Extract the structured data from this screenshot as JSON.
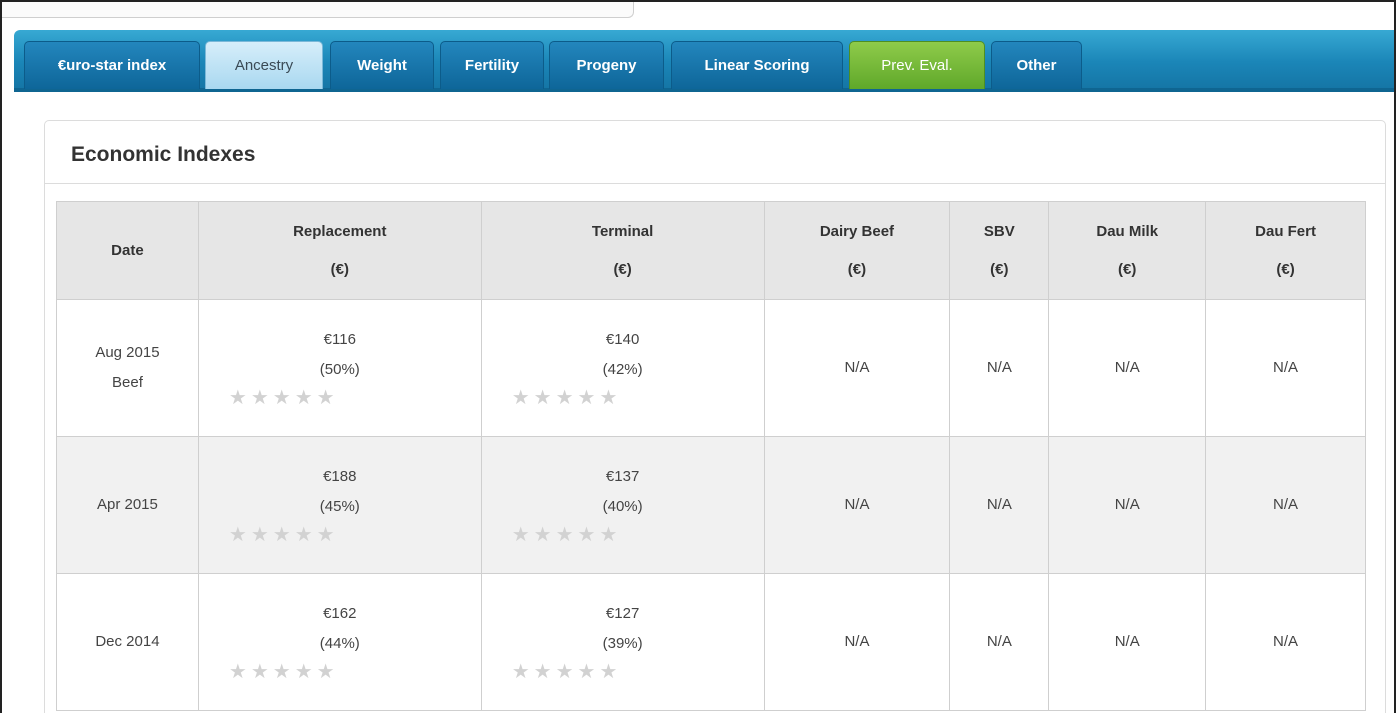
{
  "tabs": [
    {
      "label": "€uro-star index",
      "state": "default"
    },
    {
      "label": "Ancestry",
      "state": "active"
    },
    {
      "label": "Weight",
      "state": "default"
    },
    {
      "label": "Fertility",
      "state": "default"
    },
    {
      "label": "Progeny",
      "state": "default"
    },
    {
      "label": "Linear Scoring",
      "state": "default"
    },
    {
      "label": "Prev. Eval.",
      "state": "green"
    },
    {
      "label": "Other",
      "state": "default"
    }
  ],
  "panel": {
    "title": "Economic Indexes",
    "columns": [
      {
        "name": "Date",
        "unit": ""
      },
      {
        "name": "Replacement",
        "unit": "(€)"
      },
      {
        "name": "Terminal",
        "unit": "(€)"
      },
      {
        "name": "Dairy Beef",
        "unit": "(€)"
      },
      {
        "name": "SBV",
        "unit": "(€)"
      },
      {
        "name": "Dau Milk",
        "unit": "(€)"
      },
      {
        "name": "Dau Fert",
        "unit": "(€)"
      }
    ],
    "rows": [
      {
        "date": "Aug 2015",
        "date_sub": "Beef",
        "replacement": {
          "value": "€116",
          "reliability": "(50%)",
          "stars_filled": 0,
          "stars_total": 5
        },
        "terminal": {
          "value": "€140",
          "reliability": "(42%)",
          "stars_filled": 0,
          "stars_total": 5
        },
        "dairy_beef": "N/A",
        "sbv": "N/A",
        "dau_milk": "N/A",
        "dau_fert": "N/A"
      },
      {
        "date": "Apr 2015",
        "date_sub": "",
        "replacement": {
          "value": "€188",
          "reliability": "(45%)",
          "stars_filled": 0,
          "stars_total": 5
        },
        "terminal": {
          "value": "€137",
          "reliability": "(40%)",
          "stars_filled": 0,
          "stars_total": 5
        },
        "dairy_beef": "N/A",
        "sbv": "N/A",
        "dau_milk": "N/A",
        "dau_fert": "N/A"
      },
      {
        "date": "Dec 2014",
        "date_sub": "",
        "replacement": {
          "value": "€162",
          "reliability": "(44%)",
          "stars_filled": 0,
          "stars_total": 5
        },
        "terminal": {
          "value": "€127",
          "reliability": "(39%)",
          "stars_filled": 0,
          "stars_total": 5
        },
        "dairy_beef": "N/A",
        "sbv": "N/A",
        "dau_milk": "N/A",
        "dau_fert": "N/A"
      }
    ]
  },
  "icons": {
    "star": "star-icon"
  },
  "colors": {
    "tabbar": "#1b86b8",
    "tab_active": "#a9d8f0",
    "tab_green": "#6bb332",
    "header_bg": "#e6e6e6",
    "star_empty": "#d2d2d2"
  }
}
